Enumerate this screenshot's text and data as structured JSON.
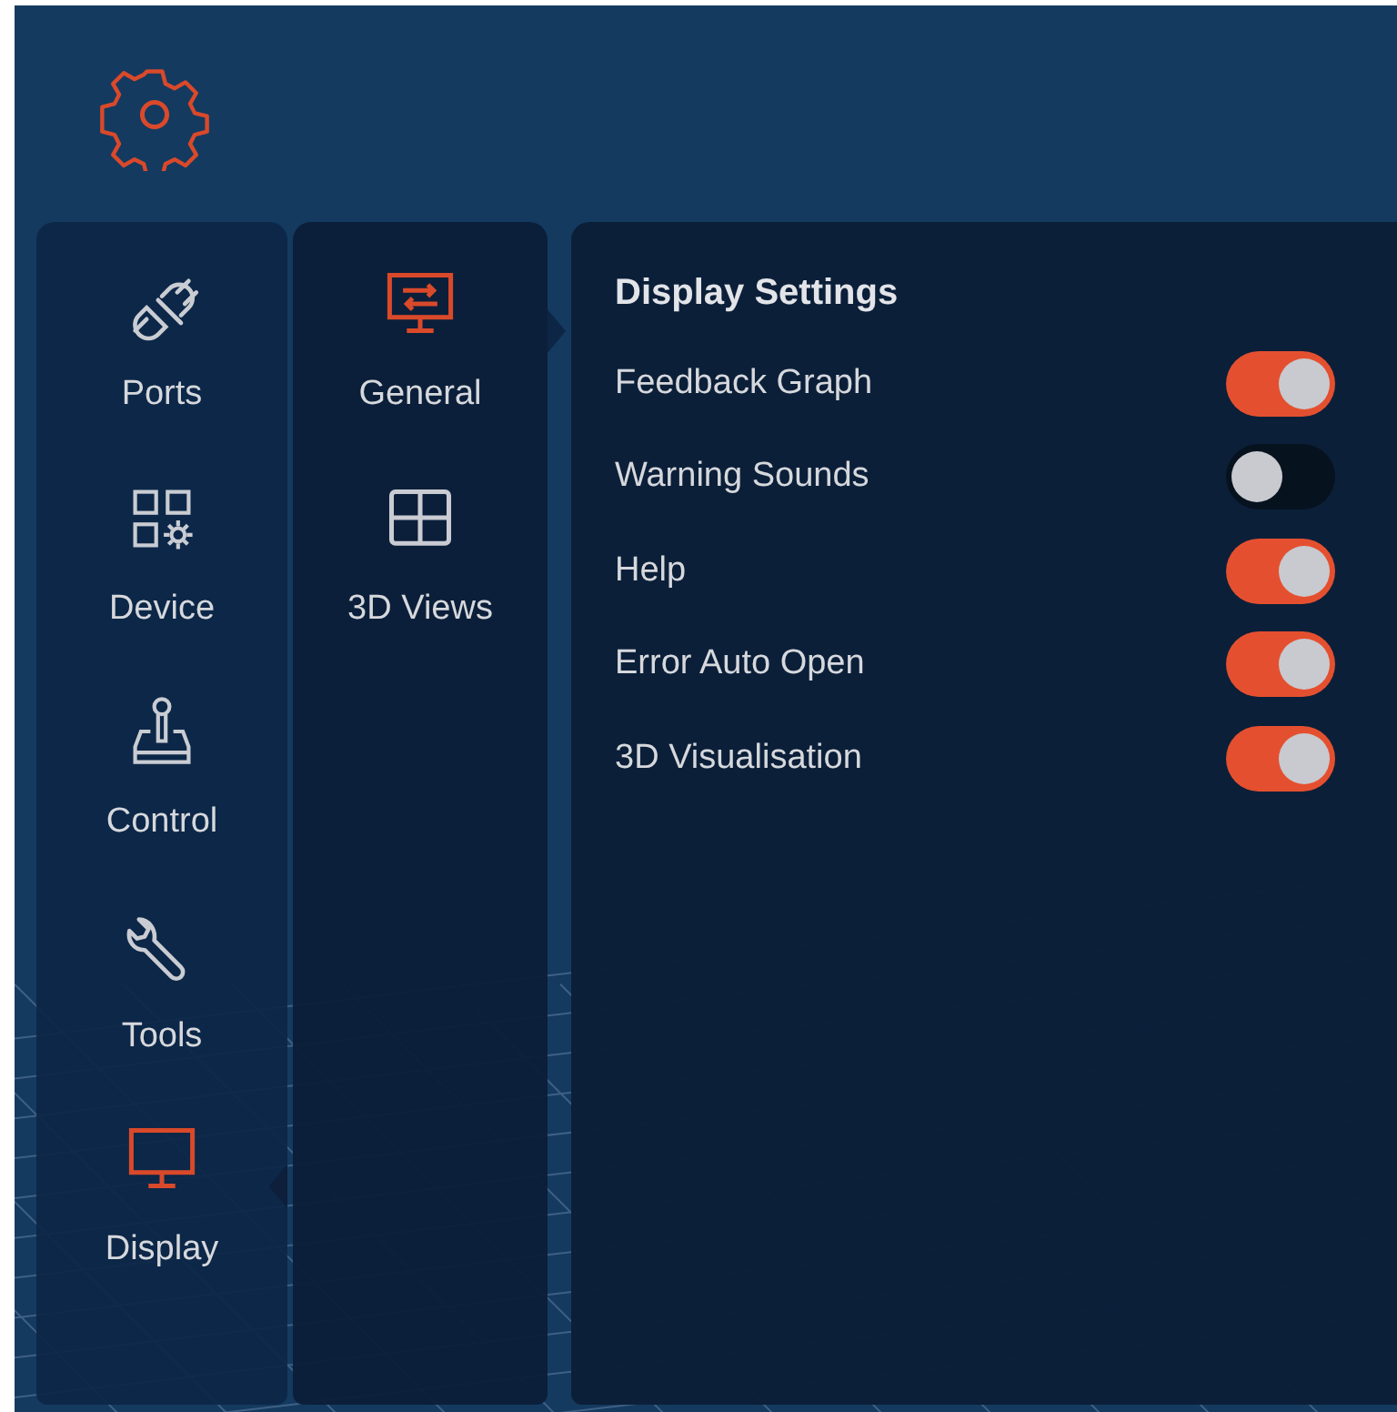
{
  "nav": {
    "items": [
      {
        "label": "Ports",
        "kind": "plug",
        "selected": false
      },
      {
        "label": "Device",
        "kind": "device",
        "selected": false
      },
      {
        "label": "Control",
        "kind": "joystick",
        "selected": false
      },
      {
        "label": "Tools",
        "kind": "wrench",
        "selected": false
      },
      {
        "label": "Display",
        "kind": "monitor",
        "selected": true
      }
    ]
  },
  "subnav": {
    "items": [
      {
        "label": "General",
        "kind": "general",
        "selected": true
      },
      {
        "label": "3D Views",
        "kind": "grid",
        "selected": false
      }
    ]
  },
  "panel": {
    "title": "Display Settings",
    "settings": [
      {
        "label": "Feedback Graph",
        "on": true
      },
      {
        "label": "Warning Sounds",
        "on": false
      },
      {
        "label": "Help",
        "on": true
      },
      {
        "label": "Error Auto Open",
        "on": true
      },
      {
        "label": "3D Visualisation",
        "on": true
      }
    ]
  }
}
